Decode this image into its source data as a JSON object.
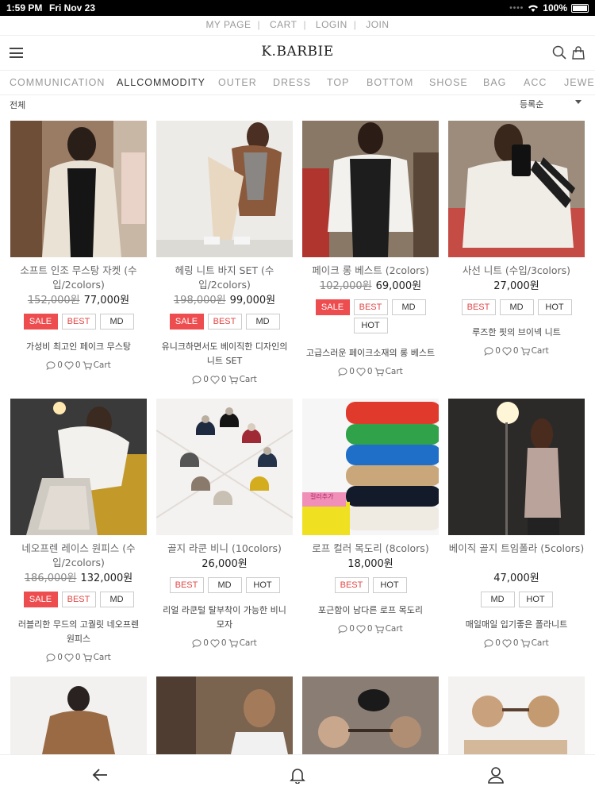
{
  "status_bar": {
    "time": "1:59 PM",
    "date": "Fri Nov 23",
    "battery": "100%"
  },
  "top_links": [
    "MY PAGE",
    "CART",
    "LOGIN",
    "JOIN"
  ],
  "header": {
    "logo": "K.BARBIE"
  },
  "categories": [
    "COMMUNICATION",
    "ALLCOMMODITY",
    "OUTER",
    "DRESS",
    "TOP",
    "BOTTOM",
    "SHOSE",
    "BAG",
    "ACC",
    "JEWELRY"
  ],
  "active_category": "ALLCOMMODITY",
  "subbar": {
    "filter_label": "전체",
    "sort_label": "등록순"
  },
  "products": [
    {
      "name": "소프트 인조 무스탕 자켓 (수입/2colors)",
      "original_price": "152,000원",
      "price": "77,000원",
      "badges": [
        "SALE",
        "BEST",
        "MD"
      ],
      "desc": "가성비 최고인 페이크 무스탕",
      "comments": "0",
      "likes": "0",
      "cart": "Cart"
    },
    {
      "name": "헤링 니트 바지 SET (수입/2colors)",
      "original_price": "198,000원",
      "price": "99,000원",
      "badges": [
        "SALE",
        "BEST",
        "MD"
      ],
      "desc": "유니크하면서도 베이직한 디자인의 니트 SET",
      "comments": "0",
      "likes": "0",
      "cart": "Cart"
    },
    {
      "name": "페이크 롱 베스트 (2colors)",
      "original_price": "102,000원",
      "price": "69,000원",
      "badges": [
        "SALE",
        "BEST",
        "MD",
        "HOT"
      ],
      "desc": "고급스러운 페이크소재의 롱 베스트",
      "comments": "0",
      "likes": "0",
      "cart": "Cart"
    },
    {
      "name": "사선 니트 (수입/3colors)",
      "original_price": "",
      "price": "27,000원",
      "badges": [
        "BEST",
        "MD",
        "HOT"
      ],
      "desc": "루즈한 핏의 브이넥 니트",
      "comments": "0",
      "likes": "0",
      "cart": "Cart"
    },
    {
      "name": "네오프렌 레이스 원피스 (수입/2colors)",
      "original_price": "186,000원",
      "price": "132,000원",
      "badges": [
        "SALE",
        "BEST",
        "MD"
      ],
      "desc": "러블리한 무드의 고퀄릿 네오프렌 원피스",
      "comments": "0",
      "likes": "0",
      "cart": "Cart"
    },
    {
      "name": "골지 라쿤 비니 (10colors)",
      "original_price": "",
      "price": "26,000원",
      "badges": [
        "BEST",
        "MD",
        "HOT"
      ],
      "desc": "리얼 라쿤털 탈부착이 가능한 비니모자",
      "comments": "0",
      "likes": "0",
      "cart": "Cart"
    },
    {
      "name": "로프 컬러 목도리 (8colors)",
      "original_price": "",
      "price": "18,000원",
      "badges": [
        "BEST",
        "HOT"
      ],
      "desc": "포근함이 남다른 로프 목도리",
      "comments": "0",
      "likes": "0",
      "cart": "Cart"
    },
    {
      "name": "베이직 골지 트임폴라 (5colors)",
      "original_price": "",
      "price": "47,000원",
      "badges": [
        "MD",
        "HOT"
      ],
      "desc": "매일매일 입기좋은 폴라니트",
      "comments": "0",
      "likes": "0",
      "cart": "Cart"
    }
  ],
  "image_label_scarf": "컬러추가"
}
